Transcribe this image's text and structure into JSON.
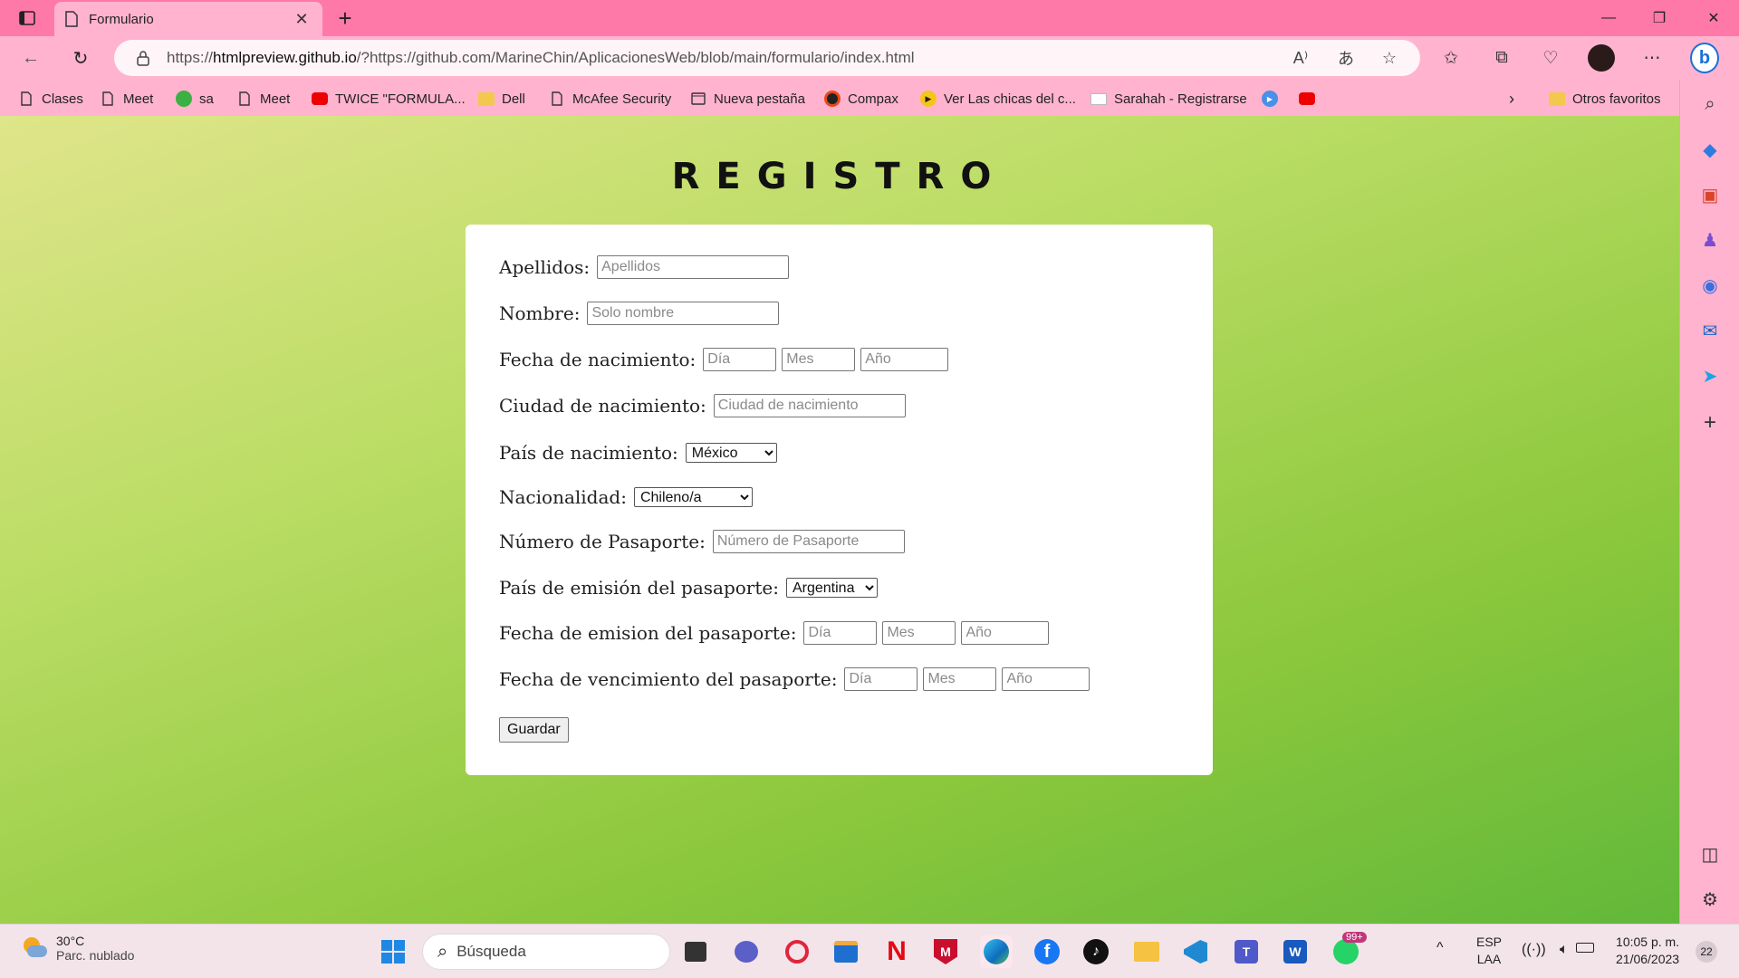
{
  "browser": {
    "tab_title": "Formulario",
    "url_prefix": "https://",
    "url_host": "htmlpreview.github.io",
    "url_rest": "/?https://github.com/MarineChin/AplicacionesWeb/blob/main/formulario/index.html",
    "read_aloud": "A⁾",
    "translate": "あ",
    "bookmarks": [
      {
        "label": "Clases",
        "icon": "page-icon"
      },
      {
        "label": "Meet",
        "icon": "page-icon"
      },
      {
        "label": "sa",
        "icon": "badge-icon"
      },
      {
        "label": "Meet",
        "icon": "page-icon"
      },
      {
        "label": "TWICE \"FORMULA...",
        "icon": "youtube-icon"
      },
      {
        "label": "Dell",
        "icon": "folder-icon"
      },
      {
        "label": "McAfee Security",
        "icon": "page-icon"
      },
      {
        "label": "Nueva pestaña",
        "icon": "newtab-icon"
      },
      {
        "label": "Compax",
        "icon": "compax-icon"
      },
      {
        "label": "Ver Las chicas del c...",
        "icon": "play-icon"
      },
      {
        "label": "Sarahah - Registrarse",
        "icon": "mail-icon"
      }
    ],
    "other_favorites": "Otros favoritos"
  },
  "form": {
    "title": "REGISTRO",
    "apellidos_label": "Apellidos:",
    "apellidos_placeholder": "Apellidos",
    "nombre_label": "Nombre:",
    "nombre_placeholder": "Solo nombre",
    "fecha_nac_label": "Fecha de nacimiento:",
    "ciudad_label": "Ciudad de nacimiento:",
    "ciudad_placeholder": "Ciudad de nacimiento",
    "pais_label": "País de nacimiento:",
    "pais_value": "México",
    "nacionalidad_label": "Nacionalidad:",
    "nacionalidad_value": "Chileno/a",
    "pasaporte_label": "Número de Pasaporte:",
    "pasaporte_placeholder": "Número de Pasaporte",
    "pais_emision_label": "País de emisión del pasaporte:",
    "pais_emision_value": "Argentina",
    "fecha_emision_label": "Fecha de emision del pasaporte:",
    "fecha_venc_label": "Fecha de vencimiento del pasaporte:",
    "dia_placeholder": "Día",
    "mes_placeholder": "Mes",
    "anio_placeholder": "Año",
    "guardar_label": "Guardar"
  },
  "taskbar": {
    "temperature": "30°C",
    "weather": "Parc. nublado",
    "search_placeholder": "Búsqueda",
    "whatsapp_badge": "99+",
    "lang_top": "ESP",
    "lang_bottom": "LAA",
    "time": "10:05 p. m.",
    "date": "21/06/2023",
    "notifications": "22"
  }
}
